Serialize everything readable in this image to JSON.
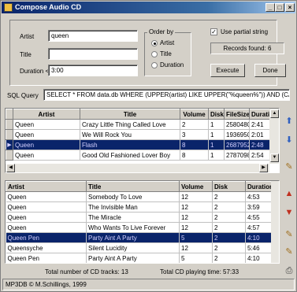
{
  "window": {
    "title": "Compose Audio CD"
  },
  "search": {
    "artist_label": "Artist",
    "artist_value": "queen",
    "title_label": "Title",
    "title_value": "",
    "duration_label": "Duration <",
    "duration_value": "3:00"
  },
  "order": {
    "label": "Order by",
    "options": [
      {
        "label": "Artist",
        "selected": true
      },
      {
        "label": "Title",
        "selected": false
      },
      {
        "label": "Duration",
        "selected": false
      }
    ]
  },
  "partial": {
    "label": "Use partial string",
    "checked": true
  },
  "records": {
    "text": "Records found: 6"
  },
  "buttons": {
    "execute": "Execute",
    "done": "Done"
  },
  "sql": {
    "label": "SQL Query",
    "value": "SELECT * FROM data.db WHERE (UPPER(artist) LIKE UPPER(\"%queen%\")) AND (CAST(\"00:\"+dur"
  },
  "results": {
    "columns": [
      "Artist",
      "Title",
      "Volume",
      "Disk",
      "FileSize",
      "Duration"
    ],
    "rows": [
      [
        "Queen",
        "Crazy Little Thing Called Love",
        "2",
        "1",
        "2580480",
        "2:41"
      ],
      [
        "Queen",
        "We Will Rock You",
        "3",
        "1",
        "1936950",
        "2:01"
      ],
      [
        "Queen",
        "Flash",
        "8",
        "1",
        "2687952",
        "2:48"
      ],
      [
        "Queen",
        "Good Old Fashioned Lover Boy",
        "8",
        "1",
        "2787098",
        "2:54"
      ]
    ],
    "selected_row": 2
  },
  "cd": {
    "columns": [
      "Artist",
      "Title",
      "Volume",
      "Disk",
      "Duration"
    ],
    "rows": [
      [
        "Queen",
        "Somebody To Love",
        "12",
        "2",
        "4:53"
      ],
      [
        "Queen",
        "The Invisible Man",
        "12",
        "2",
        "3:59"
      ],
      [
        "Queen",
        "The Miracle",
        "12",
        "2",
        "4:55"
      ],
      [
        "Queen",
        "Who Wants To Live Forever",
        "12",
        "2",
        "4:57"
      ],
      [
        "Queen Pen",
        "Party Aint A Party",
        "5",
        "2",
        "4:10"
      ],
      [
        "Queensyche",
        "Silent Lucidity",
        "12",
        "2",
        "5:46"
      ],
      [
        "Queen Pen",
        "Party Aint A Party",
        "5",
        "2",
        "4:10"
      ]
    ],
    "selected_row": 4
  },
  "totals": {
    "tracks": "Total number of CD tracks: 13",
    "time": "Total CD playing time: 57:33"
  },
  "status": {
    "text": "MP3DB © M.Schillings, 1999"
  }
}
